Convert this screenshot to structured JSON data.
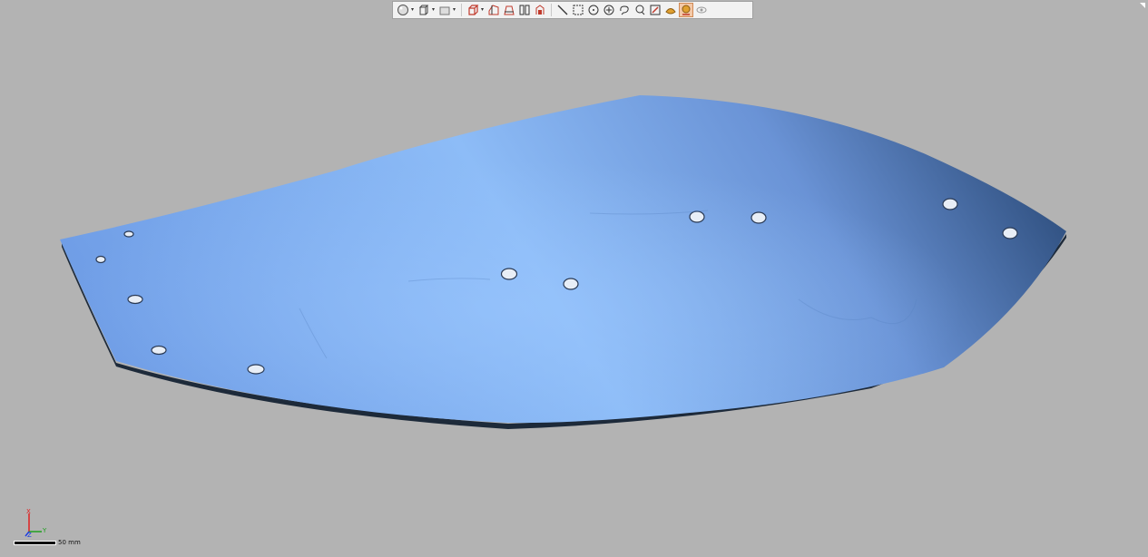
{
  "toolbar": {
    "buttons": [
      {
        "icon": "render-sphere-icon",
        "has_dropdown": true
      },
      {
        "icon": "box-view-icon",
        "has_dropdown": true
      },
      {
        "icon": "plane-view-icon",
        "has_dropdown": true
      },
      {
        "icon": "cube-select-icon",
        "has_dropdown": true
      },
      {
        "icon": "section-icon",
        "has_dropdown": false
      },
      {
        "icon": "section-plane-icon",
        "has_dropdown": false
      },
      {
        "icon": "split-view-icon",
        "has_dropdown": false
      },
      {
        "icon": "clip-icon",
        "has_dropdown": false
      },
      {
        "icon": "line-select-icon",
        "has_dropdown": false
      },
      {
        "icon": "rect-select-icon",
        "has_dropdown": false
      },
      {
        "icon": "circle-select-icon",
        "has_dropdown": false
      },
      {
        "icon": "circle-plus-icon",
        "has_dropdown": false
      },
      {
        "icon": "lasso-icon",
        "has_dropdown": false
      },
      {
        "icon": "brush-select-icon",
        "has_dropdown": false
      },
      {
        "icon": "edit-icon",
        "has_dropdown": false
      },
      {
        "icon": "surface-icon",
        "has_dropdown": false
      },
      {
        "icon": "visible-select-icon",
        "has_dropdown": false,
        "active": true
      },
      {
        "icon": "eye-icon",
        "has_dropdown": false
      }
    ]
  },
  "axis_triad": {
    "x_label": "X",
    "y_label": "Y",
    "z_label": "Z"
  },
  "scale": {
    "label": "50 mm"
  },
  "colors": {
    "background": "#b3b3b3",
    "model": "#7aa7ec",
    "model_dark": "#2e4f7a"
  }
}
